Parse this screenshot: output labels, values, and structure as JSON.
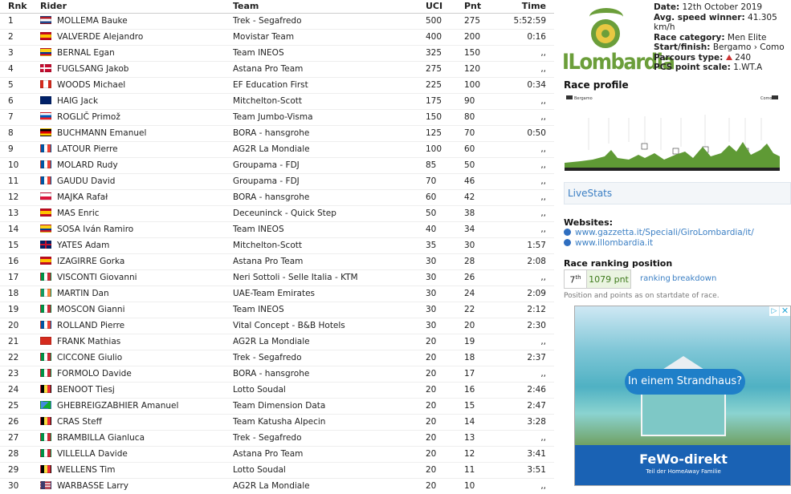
{
  "colors": {
    "link": "#3b7fc4",
    "logo_green": "#6b9e3a",
    "points_bg": "#eaf4e1",
    "ad_brand": "#1a62b4"
  },
  "table": {
    "headers": {
      "rnk": "Rnk",
      "rider": "Rider",
      "team": "Team",
      "uci": "UCI",
      "pnt": "Pnt",
      "time": "Time"
    },
    "rows": [
      {
        "rnk": "1",
        "flag": "nl",
        "rider": "MOLLEMA Bauke",
        "team": "Trek - Segafredo",
        "uci": "500",
        "pnt": "275",
        "time": "5:52:59"
      },
      {
        "rnk": "2",
        "flag": "es",
        "rider": "VALVERDE Alejandro",
        "team": "Movistar Team",
        "uci": "400",
        "pnt": "200",
        "time": "0:16"
      },
      {
        "rnk": "3",
        "flag": "co",
        "rider": "BERNAL Egan",
        "team": "Team INEOS",
        "uci": "325",
        "pnt": "150",
        "time": ",,"
      },
      {
        "rnk": "4",
        "flag": "dk",
        "rider": "FUGLSANG Jakob",
        "team": "Astana Pro Team",
        "uci": "275",
        "pnt": "120",
        "time": ",,"
      },
      {
        "rnk": "5",
        "flag": "ca",
        "rider": "WOODS Michael",
        "team": "EF Education First",
        "uci": "225",
        "pnt": "100",
        "time": "0:34"
      },
      {
        "rnk": "6",
        "flag": "au",
        "rider": "HAIG Jack",
        "team": "Mitchelton-Scott",
        "uci": "175",
        "pnt": "90",
        "time": ",,"
      },
      {
        "rnk": "7",
        "flag": "si",
        "rider": "ROGLIČ Primož",
        "team": "Team Jumbo-Visma",
        "uci": "150",
        "pnt": "80",
        "time": ",,"
      },
      {
        "rnk": "8",
        "flag": "de",
        "rider": "BUCHMANN Emanuel",
        "team": "BORA - hansgrohe",
        "uci": "125",
        "pnt": "70",
        "time": "0:50"
      },
      {
        "rnk": "9",
        "flag": "fr",
        "rider": "LATOUR Pierre",
        "team": "AG2R La Mondiale",
        "uci": "100",
        "pnt": "60",
        "time": ",,"
      },
      {
        "rnk": "10",
        "flag": "fr",
        "rider": "MOLARD Rudy",
        "team": "Groupama - FDJ",
        "uci": "85",
        "pnt": "50",
        "time": ",,"
      },
      {
        "rnk": "11",
        "flag": "fr",
        "rider": "GAUDU David",
        "team": "Groupama - FDJ",
        "uci": "70",
        "pnt": "46",
        "time": ",,"
      },
      {
        "rnk": "12",
        "flag": "pl",
        "rider": "MAJKA Rafał",
        "team": "BORA - hansgrohe",
        "uci": "60",
        "pnt": "42",
        "time": ",,"
      },
      {
        "rnk": "13",
        "flag": "es",
        "rider": "MAS Enric",
        "team": "Deceuninck - Quick Step",
        "uci": "50",
        "pnt": "38",
        "time": ",,"
      },
      {
        "rnk": "14",
        "flag": "co",
        "rider": "SOSA Iván Ramiro",
        "team": "Team INEOS",
        "uci": "40",
        "pnt": "34",
        "time": ",,"
      },
      {
        "rnk": "15",
        "flag": "gb",
        "rider": "YATES Adam",
        "team": "Mitchelton-Scott",
        "uci": "35",
        "pnt": "30",
        "time": "1:57"
      },
      {
        "rnk": "16",
        "flag": "es",
        "rider": "IZAGIRRE Gorka",
        "team": "Astana Pro Team",
        "uci": "30",
        "pnt": "28",
        "time": "2:08"
      },
      {
        "rnk": "17",
        "flag": "it",
        "rider": "VISCONTI Giovanni",
        "team": "Neri Sottoli - Selle Italia - KTM",
        "uci": "30",
        "pnt": "26",
        "time": ",,"
      },
      {
        "rnk": "18",
        "flag": "ie",
        "rider": "MARTIN Dan",
        "team": "UAE-Team Emirates",
        "uci": "30",
        "pnt": "24",
        "time": "2:09"
      },
      {
        "rnk": "19",
        "flag": "it",
        "rider": "MOSCON Gianni",
        "team": "Team INEOS",
        "uci": "30",
        "pnt": "22",
        "time": "2:12"
      },
      {
        "rnk": "20",
        "flag": "fr",
        "rider": "ROLLAND Pierre",
        "team": "Vital Concept - B&B Hotels",
        "uci": "30",
        "pnt": "20",
        "time": "2:30"
      },
      {
        "rnk": "21",
        "flag": "ch",
        "rider": "FRANK Mathias",
        "team": "AG2R La Mondiale",
        "uci": "20",
        "pnt": "19",
        "time": ",,"
      },
      {
        "rnk": "22",
        "flag": "it",
        "rider": "CICCONE Giulio",
        "team": "Trek - Segafredo",
        "uci": "20",
        "pnt": "18",
        "time": "2:37"
      },
      {
        "rnk": "23",
        "flag": "it",
        "rider": "FORMOLO Davide",
        "team": "BORA - hansgrohe",
        "uci": "20",
        "pnt": "17",
        "time": ",,"
      },
      {
        "rnk": "24",
        "flag": "be",
        "rider": "BENOOT Tiesj",
        "team": "Lotto Soudal",
        "uci": "20",
        "pnt": "16",
        "time": "2:46"
      },
      {
        "rnk": "25",
        "flag": "er",
        "rider": "GHEBREIGZABHIER Amanuel",
        "team": "Team Dimension Data",
        "uci": "20",
        "pnt": "15",
        "time": "2:47"
      },
      {
        "rnk": "26",
        "flag": "be",
        "rider": "CRAS Steff",
        "team": "Team Katusha Alpecin",
        "uci": "20",
        "pnt": "14",
        "time": "3:28"
      },
      {
        "rnk": "27",
        "flag": "it",
        "rider": "BRAMBILLA Gianluca",
        "team": "Trek - Segafredo",
        "uci": "20",
        "pnt": "13",
        "time": ",,"
      },
      {
        "rnk": "28",
        "flag": "it",
        "rider": "VILLELLA Davide",
        "team": "Astana Pro Team",
        "uci": "20",
        "pnt": "12",
        "time": "3:41"
      },
      {
        "rnk": "29",
        "flag": "be",
        "rider": "WELLENS Tim",
        "team": "Lotto Soudal",
        "uci": "20",
        "pnt": "11",
        "time": "3:51"
      },
      {
        "rnk": "30",
        "flag": "us",
        "rider": "WARBASSE Larry",
        "team": "AG2R La Mondiale",
        "uci": "20",
        "pnt": "10",
        "time": ",,"
      }
    ]
  },
  "race": {
    "logo_text": "ILombardia",
    "date_label": "Date:",
    "date": "12th October 2019",
    "speed_label": "Avg. speed winner:",
    "speed": "41.305 km/h",
    "category_label": "Race category:",
    "category": "Men Elite",
    "startfinish_label": "Start/finish:",
    "startfinish": "Bergamo › Como",
    "parcours_label": "Parcours type:",
    "parcours": "240",
    "pcs_label": "PCS point scale:",
    "pcs": "1.WT.A"
  },
  "profile": {
    "title": "Race profile",
    "start": "Bergamo",
    "finish": "Como"
  },
  "livestats": "LiveStats",
  "websites": {
    "title": "Websites:",
    "links": [
      "www.gazzetta.it/Speciali/GiroLombardia/it/",
      "www.illombardia.it"
    ]
  },
  "ranking": {
    "title": "Race ranking position",
    "position": "7",
    "position_suffix": "th",
    "points": "1079 pnt",
    "link_ranking": "ranking",
    "link_breakdown": "breakdown",
    "note": "Position and points as on startdate of race."
  },
  "ad": {
    "headline": "In einem Strandhaus?",
    "brand": "FeWo-direkt",
    "brand_sub": "Teil der HomeAway Familie",
    "adchoices": "▷",
    "close": "✕"
  }
}
